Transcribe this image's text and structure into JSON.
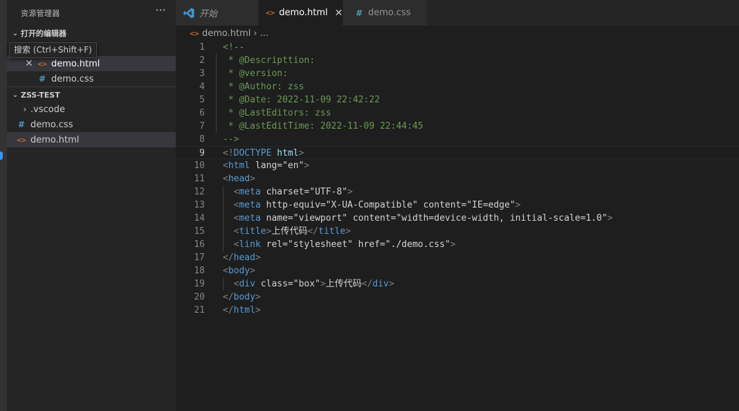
{
  "sidebar": {
    "title": "资源管理器",
    "more_label": "···",
    "open_editors": {
      "label": "打开的编辑器",
      "items": [
        {
          "name": "demo.html",
          "type": "html"
        },
        {
          "name": "demo.css",
          "type": "css"
        }
      ]
    },
    "tooltip": "搜索 (Ctrl+Shift+F)",
    "workspace": {
      "label": "ZSS-TEST",
      "items": [
        {
          "name": ".vscode",
          "type": "folder"
        },
        {
          "name": "demo.css",
          "type": "css"
        },
        {
          "name": "demo.html",
          "type": "html"
        }
      ]
    }
  },
  "tabs": [
    {
      "label": "开始",
      "icon": "vscode-icon"
    },
    {
      "label": "demo.html",
      "icon": "html-icon"
    },
    {
      "label": "demo.css",
      "icon": "css-icon"
    }
  ],
  "breadcrumb": {
    "file": "demo.html",
    "rest": "..."
  },
  "editor": {
    "current_line": 9,
    "lines": [
      "<!--",
      " * @Descripttion:",
      " * @version:",
      " * @Author: zss",
      " * @Date: 2022-11-09 22:42:22",
      " * @LastEditors: zss",
      " * @LastEditTime: 2022-11-09 22:44:45",
      "-->",
      "<!DOCTYPE html>",
      "<html lang=\"en\">",
      "<head>",
      "  <meta charset=\"UTF-8\">",
      "  <meta http-equiv=\"X-UA-Compatible\" content=\"IE=edge\">",
      "  <meta name=\"viewport\" content=\"width=device-width, initial-scale=1.0\">",
      "  <title>上传代码</title>",
      "  <link rel=\"stylesheet\" href=\"./demo.css\">",
      "</head>",
      "<body>",
      "  <div class=\"box\">上传代码</div>",
      "</body>",
      "</html>"
    ]
  },
  "colors": {
    "comment": "#6a9955",
    "tag": "#569cd6",
    "attribute": "#9cdcfe",
    "string": "#ce9178",
    "html_icon": "#e37933",
    "css_icon": "#519aba"
  }
}
